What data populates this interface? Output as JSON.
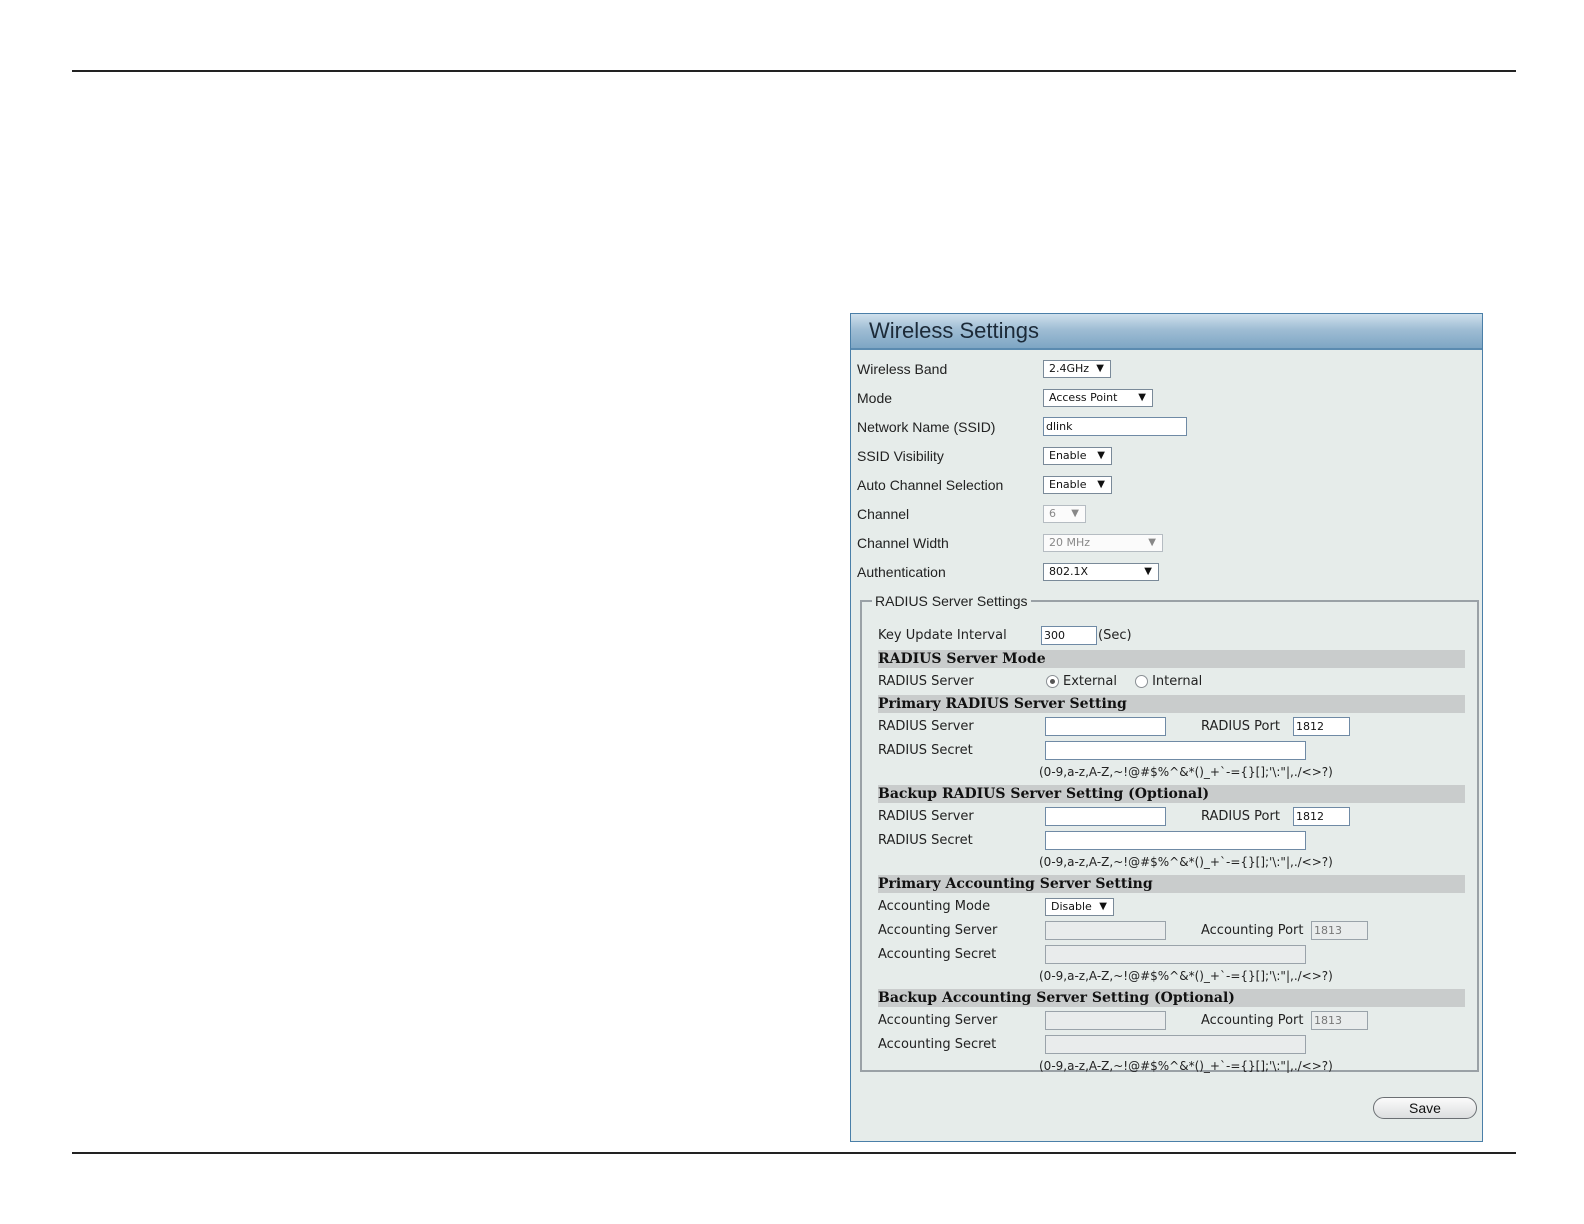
{
  "panel": {
    "title": "Wireless Settings"
  },
  "fields": {
    "wireless_band": {
      "label": "Wireless Band",
      "value": "2.4GHz"
    },
    "mode": {
      "label": "Mode",
      "value": "Access Point"
    },
    "ssid": {
      "label": "Network Name (SSID)",
      "value": "dlink"
    },
    "ssid_visibility": {
      "label": "SSID Visibility",
      "value": "Enable"
    },
    "auto_channel": {
      "label": "Auto Channel Selection",
      "value": "Enable"
    },
    "channel": {
      "label": "Channel",
      "value": "6"
    },
    "channel_width": {
      "label": "Channel Width",
      "value": "20 MHz"
    },
    "authentication": {
      "label": "Authentication",
      "value": "802.1X"
    }
  },
  "radius": {
    "legend": "RADIUS Server Settings",
    "key_update": {
      "label": "Key Update Interval",
      "value": "300",
      "unit": "(Sec)"
    },
    "mode_head": "RADIUS Server Mode",
    "mode_row": {
      "label": "RADIUS Server",
      "opt_external": "External",
      "opt_internal": "Internal"
    },
    "primary": {
      "head": "Primary RADIUS Server Setting",
      "server_label": "RADIUS Server",
      "server_value": "",
      "port_label": "RADIUS Port",
      "port_value": "1812",
      "secret_label": "RADIUS Secret",
      "secret_value": "",
      "hint": "(0-9,a-z,A-Z,~!@#$%^&*()_+`-={}[];'\\:\"|,./<>?)"
    },
    "backup": {
      "head": "Backup RADIUS Server Setting (Optional)",
      "server_label": "RADIUS Server",
      "server_value": "",
      "port_label": "RADIUS Port",
      "port_value": "1812",
      "secret_label": "RADIUS Secret",
      "secret_value": "",
      "hint": "(0-9,a-z,A-Z,~!@#$%^&*()_+`-={}[];'\\:\"|,./<>?)"
    },
    "acct_primary": {
      "head": "Primary Accounting Server Setting",
      "mode_label": "Accounting Mode",
      "mode_value": "Disable",
      "server_label": "Accounting Server",
      "server_value": "",
      "port_label": "Accounting Port",
      "port_value": "1813",
      "secret_label": "Accounting Secret",
      "secret_value": "",
      "hint": "(0-9,a-z,A-Z,~!@#$%^&*()_+`-={}[];'\\:\"|,./<>?)"
    },
    "acct_backup": {
      "head": "Backup Accounting Server Setting (Optional)",
      "server_label": "Accounting Server",
      "server_value": "",
      "port_label": "Accounting Port",
      "port_value": "1813",
      "secret_label": "Accounting Secret",
      "secret_value": "",
      "hint": "(0-9,a-z,A-Z,~!@#$%^&*()_+`-={}[];'\\:\"|,./<>?)"
    }
  },
  "actions": {
    "save_label": "Save"
  }
}
